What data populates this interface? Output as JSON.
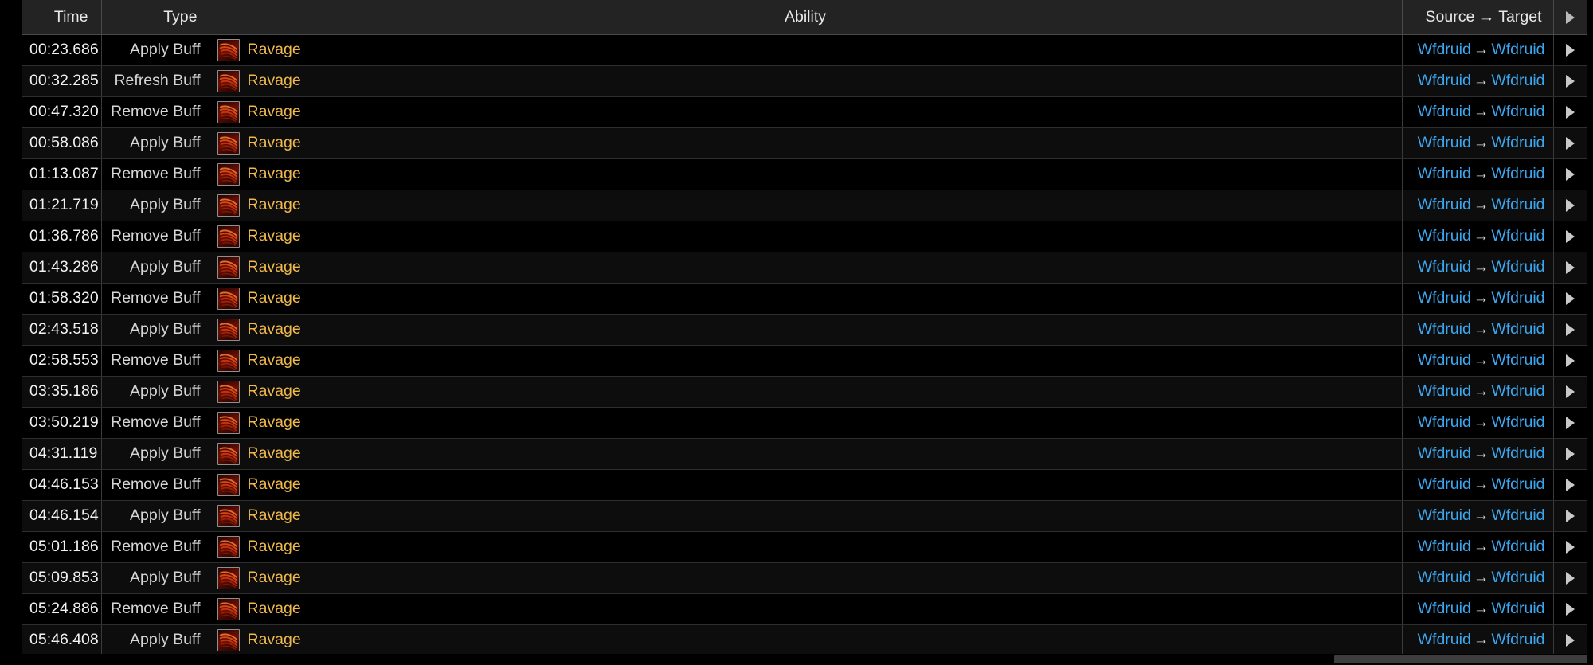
{
  "table": {
    "columns": [
      {
        "key": "time",
        "label": "Time"
      },
      {
        "key": "type",
        "label": "Type"
      },
      {
        "key": "ability",
        "label": "Ability"
      },
      {
        "key": "st",
        "label": "Source → Target"
      },
      {
        "key": "expand",
        "label": ""
      }
    ],
    "header_expand_icon": "caret-right-icon",
    "ability_icon_name": "ravage-ability-icon",
    "arrow_glyph": "→",
    "colors": {
      "header_bg": "#232323",
      "row_bg_odd": "#000000",
      "row_bg_even": "#0d0d0d",
      "ability_text": "#f0b94a",
      "source_target_text": "#3ba7f0",
      "time_text": "#f2f2f2",
      "type_text": "#d6d6d6",
      "border": "#3a3a3a",
      "icon_accent": "#e03a10"
    },
    "rows": [
      {
        "time": "00:23.686",
        "type": "Apply Buff",
        "ability": "Ravage",
        "source": "Wfdruid",
        "target": "Wfdruid"
      },
      {
        "time": "00:32.285",
        "type": "Refresh Buff",
        "ability": "Ravage",
        "source": "Wfdruid",
        "target": "Wfdruid"
      },
      {
        "time": "00:47.320",
        "type": "Remove Buff",
        "ability": "Ravage",
        "source": "Wfdruid",
        "target": "Wfdruid"
      },
      {
        "time": "00:58.086",
        "type": "Apply Buff",
        "ability": "Ravage",
        "source": "Wfdruid",
        "target": "Wfdruid"
      },
      {
        "time": "01:13.087",
        "type": "Remove Buff",
        "ability": "Ravage",
        "source": "Wfdruid",
        "target": "Wfdruid"
      },
      {
        "time": "01:21.719",
        "type": "Apply Buff",
        "ability": "Ravage",
        "source": "Wfdruid",
        "target": "Wfdruid"
      },
      {
        "time": "01:36.786",
        "type": "Remove Buff",
        "ability": "Ravage",
        "source": "Wfdruid",
        "target": "Wfdruid"
      },
      {
        "time": "01:43.286",
        "type": "Apply Buff",
        "ability": "Ravage",
        "source": "Wfdruid",
        "target": "Wfdruid"
      },
      {
        "time": "01:58.320",
        "type": "Remove Buff",
        "ability": "Ravage",
        "source": "Wfdruid",
        "target": "Wfdruid"
      },
      {
        "time": "02:43.518",
        "type": "Apply Buff",
        "ability": "Ravage",
        "source": "Wfdruid",
        "target": "Wfdruid"
      },
      {
        "time": "02:58.553",
        "type": "Remove Buff",
        "ability": "Ravage",
        "source": "Wfdruid",
        "target": "Wfdruid"
      },
      {
        "time": "03:35.186",
        "type": "Apply Buff",
        "ability": "Ravage",
        "source": "Wfdruid",
        "target": "Wfdruid"
      },
      {
        "time": "03:50.219",
        "type": "Remove Buff",
        "ability": "Ravage",
        "source": "Wfdruid",
        "target": "Wfdruid"
      },
      {
        "time": "04:31.119",
        "type": "Apply Buff",
        "ability": "Ravage",
        "source": "Wfdruid",
        "target": "Wfdruid"
      },
      {
        "time": "04:46.153",
        "type": "Remove Buff",
        "ability": "Ravage",
        "source": "Wfdruid",
        "target": "Wfdruid"
      },
      {
        "time": "04:46.154",
        "type": "Apply Buff",
        "ability": "Ravage",
        "source": "Wfdruid",
        "target": "Wfdruid"
      },
      {
        "time": "05:01.186",
        "type": "Remove Buff",
        "ability": "Ravage",
        "source": "Wfdruid",
        "target": "Wfdruid"
      },
      {
        "time": "05:09.853",
        "type": "Apply Buff",
        "ability": "Ravage",
        "source": "Wfdruid",
        "target": "Wfdruid"
      },
      {
        "time": "05:24.886",
        "type": "Remove Buff",
        "ability": "Ravage",
        "source": "Wfdruid",
        "target": "Wfdruid"
      },
      {
        "time": "05:46.408",
        "type": "Apply Buff",
        "ability": "Ravage",
        "source": "Wfdruid",
        "target": "Wfdruid"
      }
    ]
  },
  "scrollbar": {
    "orientation": "horizontal",
    "name": "horizontal-scrollbar"
  }
}
